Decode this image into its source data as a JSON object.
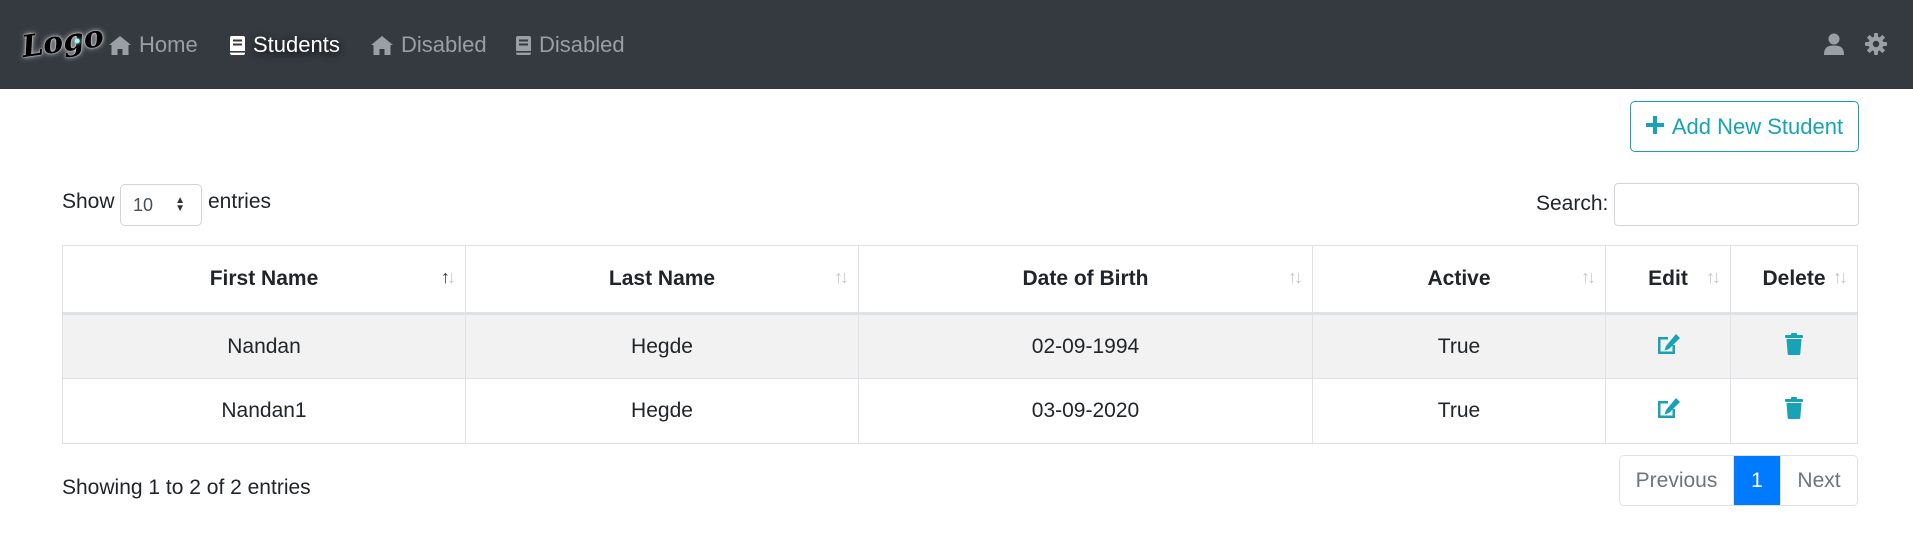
{
  "navbar": {
    "logo_text": "Logo",
    "items": [
      {
        "label": "Home",
        "icon": "home-icon",
        "active": false
      },
      {
        "label": "Students",
        "icon": "book-icon",
        "active": true
      },
      {
        "label": "Disabled",
        "icon": "home-icon",
        "active": false
      },
      {
        "label": "Disabled",
        "icon": "book-icon",
        "active": false
      }
    ],
    "right_icons": [
      "user-icon",
      "gear-icon"
    ]
  },
  "toolbar": {
    "add_label": "Add New Student"
  },
  "length": {
    "show_label": "Show",
    "selected": "10",
    "entries_label": "entries"
  },
  "search": {
    "label": "Search:",
    "value": ""
  },
  "table": {
    "columns": [
      "First Name",
      "Last Name",
      "Date of Birth",
      "Active",
      "Edit",
      "Delete"
    ],
    "rows": [
      {
        "first": "Nandan",
        "last": "Hegde",
        "dob": "02-09-1994",
        "active": "True"
      },
      {
        "first": "Nandan1",
        "last": "Hegde",
        "dob": "03-09-2020",
        "active": "True"
      }
    ]
  },
  "info": "Showing 1 to 2 of 2 entries",
  "pagination": {
    "previous": "Previous",
    "current": "1",
    "next": "Next"
  },
  "colors": {
    "navbar": "#343a40",
    "accent": "#17a2b8",
    "page_active": "#007bff"
  }
}
